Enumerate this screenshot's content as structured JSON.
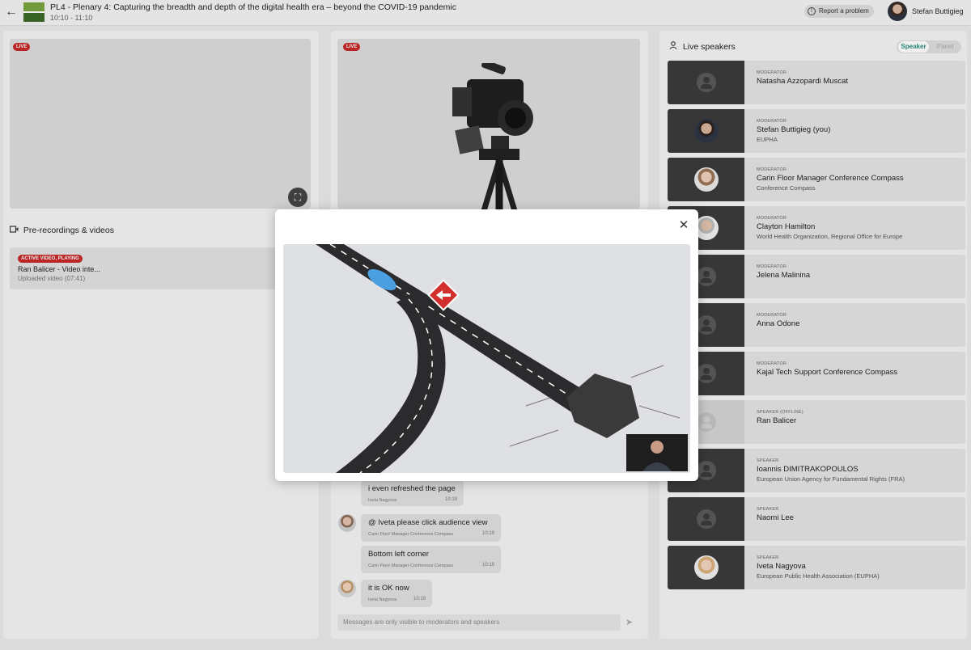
{
  "header": {
    "title": "PL4 - Plenary 4: Capturing the breadth and depth of the digital health era – beyond the COVID-19 pandemic",
    "time": "10:10 - 11:10",
    "report_label": "Report a problem",
    "user_name": "Stefan Buttigieg"
  },
  "left": {
    "live_label": "LIVE",
    "section_title": "Pre-recordings & videos",
    "prerec": {
      "badge": "ACTIVE VIDEO, PLAYING",
      "title": "Ran Balicer - Video inte...",
      "subtitle": "Uploaded video (07:41)"
    }
  },
  "middle": {
    "live_label": "LIVE",
    "messages": [
      {
        "text": "i even refreshed the page",
        "author": "Iveta Nagyova",
        "time": "10:19"
      },
      {
        "text": "@ Iveta please click audience view",
        "author": "Carin Floor Manager Conference Compass",
        "time": "10:19"
      },
      {
        "text": "Bottom left corner",
        "author": "Carin Floor Manager Conference Compass",
        "time": "10:19"
      },
      {
        "text": "it is OK now",
        "author": "Iveta Nagyova",
        "time": "10:19"
      }
    ],
    "input_placeholder": "Messages are only visible to moderators and speakers"
  },
  "right": {
    "title": "Live speakers",
    "toggle": {
      "speaker": "Speaker",
      "panel": "Panel"
    },
    "speakers": [
      {
        "role": "MODERATOR",
        "name": "Natasha Azzopardi Muscat",
        "org": ""
      },
      {
        "role": "MODERATOR",
        "name": "Stefan Buttigieg (you)",
        "org": "EUPHA"
      },
      {
        "role": "MODERATOR",
        "name": "Carin Floor Manager Conference Compass",
        "org": "Conference Compass"
      },
      {
        "role": "MODERATOR",
        "name": "Clayton Hamilton",
        "org": "World Health Organization, Regional Office for Europe"
      },
      {
        "role": "MODERATOR",
        "name": "Jelena Malinina",
        "org": ""
      },
      {
        "role": "MODERATOR",
        "name": "Anna Odone",
        "org": ""
      },
      {
        "role": "MODERATOR",
        "name": "Kajal Tech Support Conference Compass",
        "org": ""
      },
      {
        "role": "SPEAKER (OFFLINE)",
        "name": "Ran Balicer",
        "org": ""
      },
      {
        "role": "SPEAKER",
        "name": "Ioannis DIMITRAKOPOULOS",
        "org": "European Union Agency for Fundamental Rights (FRA)"
      },
      {
        "role": "SPEAKER",
        "name": "Naomi Lee",
        "org": ""
      },
      {
        "role": "SPEAKER",
        "name": "Iveta Nagyova",
        "org": "European Public Health Association (EUPHA)"
      }
    ]
  },
  "icons": {
    "back": "←",
    "close": "✕",
    "fullscreen": "⛶",
    "send": "➤",
    "person": "👤",
    "video": "▢"
  },
  "colors": {
    "live_badge": "#c62828",
    "toggle_active": "#2a8d7b"
  }
}
